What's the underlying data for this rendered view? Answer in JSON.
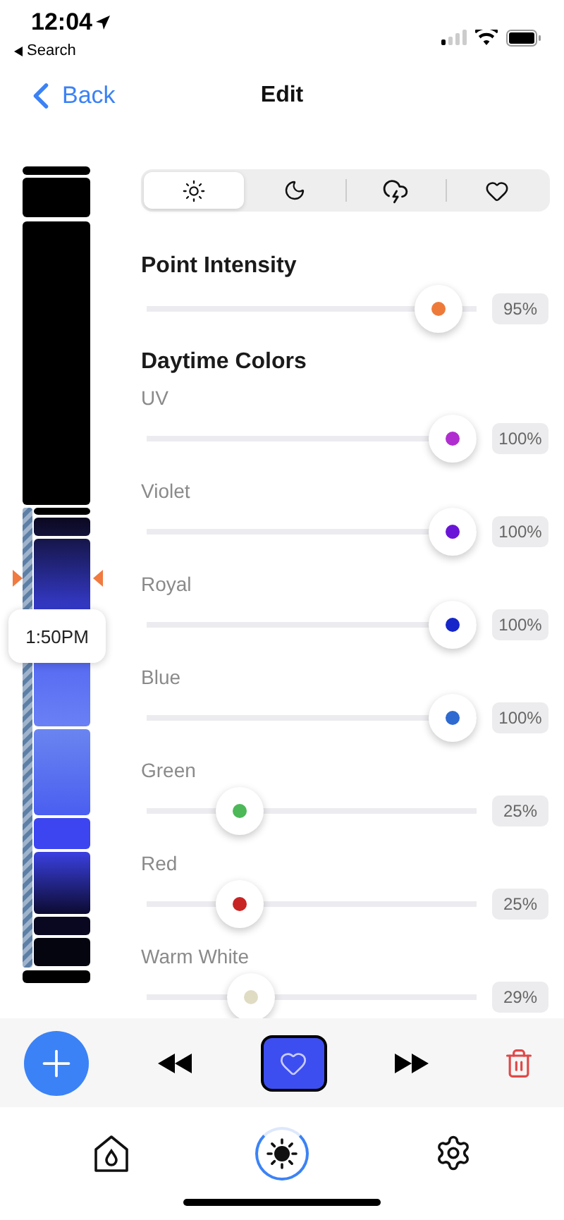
{
  "status_bar": {
    "time": "12:04",
    "back_app": "Search"
  },
  "nav": {
    "back": "Back",
    "title": "Edit"
  },
  "timeline": {
    "current_time": "1:50PM"
  },
  "mode_tabs": [
    {
      "kind": "sun",
      "selected": true
    },
    {
      "kind": "moon",
      "selected": false
    },
    {
      "kind": "storm",
      "selected": false
    },
    {
      "kind": "heart",
      "selected": false
    }
  ],
  "intensity": {
    "title": "Point Intensity",
    "level": 0.95,
    "reading": "95%",
    "color": "#ee7a3a"
  },
  "colors_title": "Daytime Colors",
  "channels": [
    {
      "name": "UV",
      "level": 1,
      "reading": "100%",
      "color": "#b02ed0"
    },
    {
      "name": "Violet",
      "level": 1,
      "reading": "100%",
      "color": "#6a14d8"
    },
    {
      "name": "Royal",
      "level": 1,
      "reading": "100%",
      "color": "#1626c8"
    },
    {
      "name": "Blue",
      "level": 1,
      "reading": "100%",
      "color": "#2e6ad0"
    },
    {
      "name": "Green",
      "level": 0.25,
      "reading": "25%",
      "color": "#4cb858"
    },
    {
      "name": "Red",
      "level": 0.25,
      "reading": "25%",
      "color": "#c82424"
    },
    {
      "name": "Warm White",
      "level": 0.29,
      "reading": "29%",
      "color": "#e0dcc4"
    }
  ],
  "toolbar": [
    {
      "kind": "add"
    },
    {
      "kind": "rewind"
    },
    {
      "kind": "favorite",
      "selected": true
    },
    {
      "kind": "forward"
    },
    {
      "kind": "delete"
    }
  ],
  "bottom_tabs": [
    {
      "kind": "home",
      "selected": false
    },
    {
      "kind": "lighting",
      "selected": true
    },
    {
      "kind": "settings",
      "selected": false
    }
  ]
}
